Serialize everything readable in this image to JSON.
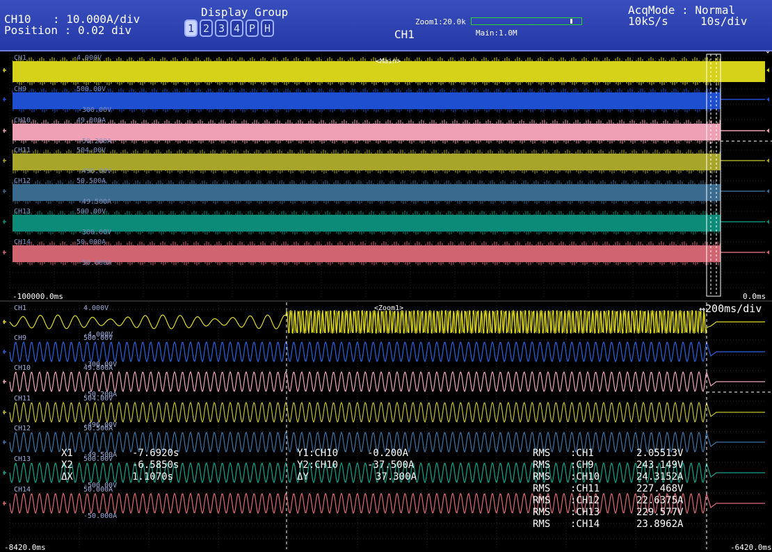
{
  "header": {
    "channel": "CH10",
    "scale_label": ": 10.000A/div",
    "position_label": "Position : 0.02 div",
    "display_group_title": "Display Group",
    "display_group_buttons": [
      "1",
      "2",
      "3",
      "4",
      "P",
      "H"
    ],
    "active_group": "1",
    "zoom_label": "Zoom1:20.0k",
    "main_label": "Main:1.0M",
    "center_channel": "CH1",
    "acq_mode": "AcqMode : Normal",
    "sample_rate": "10kS/s",
    "time_div": "10s/div"
  },
  "main_window": {
    "tag": "<Main>",
    "left_time": "-100000.0ms",
    "right_time": "0.0ms",
    "channels": [
      {
        "name": "CH1",
        "top": "4.000V",
        "bottom": "",
        "color": "#d6d21a"
      },
      {
        "name": "CH9",
        "top": "500.00V",
        "bottom": "-300.00V",
        "color": "#1e4fd0"
      },
      {
        "name": "CH10",
        "top": "49.800A",
        "bottom": "-50.200A",
        "color": "#f0a0b4"
      },
      {
        "name": "CH11",
        "top": "504.00V",
        "bottom": "-496.00V",
        "color": "#a8a62a"
      },
      {
        "name": "CH12",
        "top": "50.500A",
        "bottom": "-49.500A",
        "color": "#3a6a8e"
      },
      {
        "name": "CH13",
        "top": "500.00V",
        "bottom": "-300.00V",
        "color": "#0c8c78"
      },
      {
        "name": "CH14",
        "top": "50.000A",
        "bottom": "-50.000A",
        "color": "#d06470"
      }
    ]
  },
  "zoom_window": {
    "tag": "<Zoom1>",
    "time_div": "↔200ms/div",
    "left_time": "-8420.0ms",
    "right_time": "-6420.0ms",
    "channels": [
      {
        "name": "CH1",
        "top": "4.000V",
        "bottom": "-4.000V"
      },
      {
        "name": "CH9",
        "top": "500.00V",
        "bottom": "-300.00V"
      },
      {
        "name": "CH10",
        "top": "49.800A",
        "bottom": "-50.200A"
      },
      {
        "name": "CH11",
        "top": "504.00V",
        "bottom": "-496.00V"
      },
      {
        "name": "CH12",
        "top": "50.500A",
        "bottom": "-49.500A"
      },
      {
        "name": "CH13",
        "top": "500.00V",
        "bottom": "-500.00V"
      },
      {
        "name": "CH14",
        "top": "50.000A",
        "bottom": "-50.000A"
      }
    ]
  },
  "cursors": {
    "x1_label": "X1",
    "x1_value": "-7.6920s",
    "x2_label": "X2",
    "x2_value": "-6.5850s",
    "dx_label": "ΔX",
    "dx_value": "1.1070s",
    "y1_label": "Y1:CH10",
    "y1_value": "-0.200A",
    "y2_label": "Y2:CH10",
    "y2_value": "-37.500A",
    "dy_label": "ΔY",
    "dy_value": "37.300A"
  },
  "measurements": [
    {
      "type": "RMS",
      "channel": ":CH1",
      "value": "2.05513V"
    },
    {
      "type": "RMS",
      "channel": ":CH9",
      "value": "243.149V"
    },
    {
      "type": "RMS",
      "channel": ":CH10",
      "value": "24.3152A"
    },
    {
      "type": "RMS",
      "channel": ":CH11",
      "value": "227.468V"
    },
    {
      "type": "RMS",
      "channel": ":CH12",
      "value": "22.6375A"
    },
    {
      "type": "RMS",
      "channel": ":CH13",
      "value": "229.577V"
    },
    {
      "type": "RMS",
      "channel": ":CH14",
      "value": "23.8962A"
    }
  ]
}
